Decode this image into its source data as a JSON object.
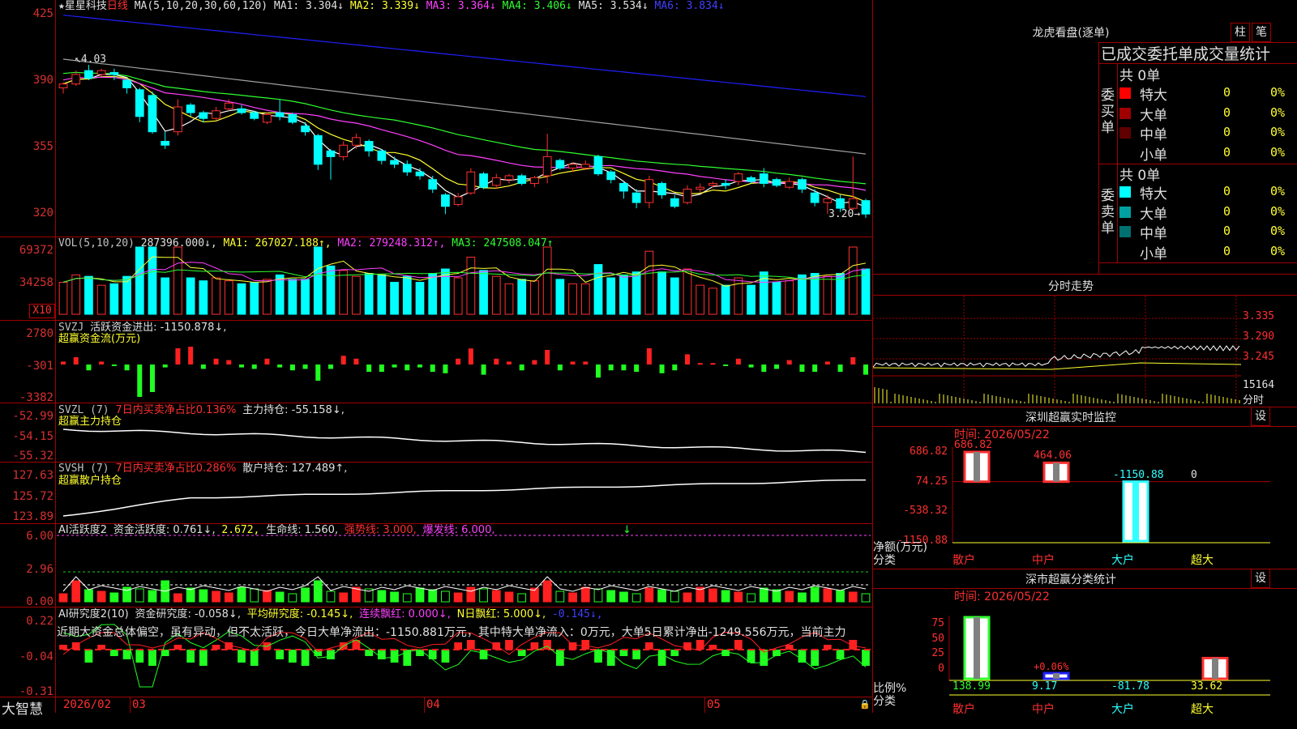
{
  "header": {
    "star": "★",
    "name": "星星科技",
    "period": "日线",
    "ma_label": "MA(5,10,20,30,60,120)",
    "ma1": "MA1: 3.304↓",
    "ma2": "MA2: 3.339↓",
    "ma3": "MA3: 3.364↓",
    "ma4": "MA4: 3.406↓",
    "ma5": "MA5: 3.534↓",
    "ma6": "MA6: 3.834↓",
    "high_tag": "4.03",
    "low_tag": "3.20"
  },
  "price_axis": [
    "425",
    "390",
    "355",
    "320"
  ],
  "vol": {
    "label": "VOL(5,10,20)",
    "value": "287396.000↓,",
    "ma1": "MA1: 267027.188↑,",
    "ma2": "MA2: 279248.312↑,",
    "ma3": "MA3: 247508.047↑",
    "axis": [
      "69372",
      "34258"
    ],
    "unit": "X10"
  },
  "svzj": {
    "label": "SVZJ",
    "text": "活跃资金进出: -1150.878↓,",
    "sub": "超赢资金流(万元)",
    "axis": [
      "2780",
      "-301",
      "-3382"
    ]
  },
  "svzl": {
    "label": "SVZL (7)",
    "text1": "7日内买卖净占比0.136%",
    "text2": "主力持仓: -55.158↓,",
    "sub": "超赢主力持仓",
    "axis": [
      "-52.99",
      "-54.15",
      "-55.32"
    ]
  },
  "svsh": {
    "label": "SVSH (7)",
    "text1": "7日内买卖净占比0.286%",
    "text2": "散户持仓: 127.489↑,",
    "sub": "超赢散户持仓",
    "axis": [
      "127.63",
      "125.72",
      "123.89"
    ]
  },
  "ai1": {
    "label": "AI活跃度2",
    "t1": "资金活跃度: 0.761↓,",
    "t2": "2.672,",
    "t3": "生命线: 1.560,",
    "t4": "强势线: 3.000,",
    "t5": "爆发线: 6.000,",
    "arrow": "↓",
    "axis": [
      "6.00",
      "2.96",
      "0.00"
    ]
  },
  "ai2": {
    "label": "AI研究度2(10)",
    "t1": "资金研究度: -0.058↓,",
    "t2": "平均研究度: -0.145↓,",
    "t3": "连续飘红: 0.000↓,",
    "t4": "N日飘红: 5.000↓,",
    "t5": "-0.145↓,",
    "desc": "近期大资金总体偏空，虽有异动，但不太活跃，今日大单净流出：-1150.881万元，其中特大单净流入：0万元，大单5日累计净出-1249.556万元，当前主力",
    "axis": [
      "0.22",
      "-0.04",
      "-0.31"
    ]
  },
  "bottom": {
    "brand": "大智慧",
    "dates": [
      "2026/02",
      "03",
      "04",
      "05"
    ]
  },
  "lhkp": {
    "title": "龙虎看盘(逐单)",
    "btn1": "柱",
    "btn2": "笔",
    "header": "已成交委托单成交量统计",
    "buy_side": "委买单",
    "sell_side": "委卖单",
    "buy_total": "共 0单",
    "sell_total": "共 0单",
    "buy_rows": [
      {
        "label": "特大",
        "count": "0",
        "pct": "0%",
        "color": "#ff0000"
      },
      {
        "label": "大单",
        "count": "0",
        "pct": "0%",
        "color": "#a00000"
      },
      {
        "label": "中单",
        "count": "0",
        "pct": "0%",
        "color": "#600000"
      },
      {
        "label": "小单",
        "count": "0",
        "pct": "0%",
        "color": ""
      }
    ],
    "sell_rows": [
      {
        "label": "特大",
        "count": "0",
        "pct": "0%",
        "color": "#00ffff"
      },
      {
        "label": "大单",
        "count": "0",
        "pct": "0%",
        "color": "#00a0a0"
      },
      {
        "label": "中单",
        "count": "0",
        "pct": "0%",
        "color": "#007070"
      },
      {
        "label": "小单",
        "count": "0",
        "pct": "0%",
        "color": ""
      }
    ]
  },
  "fenshi": {
    "title": "分时走势",
    "axis": [
      "3.335",
      "3.290",
      "3.245"
    ],
    "vol_label": "15164",
    "time_label": "分时"
  },
  "monitor": {
    "title": "深圳超赢实时监控",
    "btn": "设",
    "time": "时间: 2026/05/22",
    "axis": [
      "686.82",
      "74.25",
      "-538.32",
      "-1150.88"
    ],
    "values": [
      {
        "category": "散户",
        "value": 686.82,
        "label": "686.82"
      },
      {
        "category": "中户",
        "value": 464.06,
        "label": "464.06"
      },
      {
        "category": "大户",
        "value": -1150.88,
        "label": "-1150.88"
      },
      {
        "category": "超大",
        "value": 0,
        "label": "0"
      }
    ],
    "ylabel": "净额(万元)",
    "xlabel": "分类"
  },
  "classify": {
    "title": "深市超赢分类统计",
    "btn": "设",
    "time": "时间: 2026/05/22",
    "axis": [
      "75",
      "50",
      "25",
      "0"
    ],
    "values": [
      {
        "category": "散户",
        "pct": 138.99,
        "label": "138.99"
      },
      {
        "category": "中户",
        "pct": 9.17,
        "label": "9.17",
        "sub": "+0.06%"
      },
      {
        "category": "大户",
        "pct": -81.78,
        "label": "-81.78"
      },
      {
        "category": "超大",
        "pct": 33.62,
        "label": "33.62"
      }
    ],
    "ylabel": "比例%",
    "xlabel": "分类"
  },
  "chart_data": {
    "type": "candlestick",
    "title": "星星科技 日线",
    "ylim": [
      3.2,
      4.3
    ],
    "candles": [
      [
        3.88,
        3.9,
        3.85,
        3.91
      ],
      [
        3.9,
        3.95,
        3.89,
        3.97
      ],
      [
        3.97,
        3.93,
        3.92,
        4.0
      ],
      [
        3.95,
        3.97,
        3.94,
        3.98
      ],
      [
        3.96,
        3.95,
        3.92,
        3.98
      ],
      [
        3.92,
        3.88,
        3.85,
        3.93
      ],
      [
        3.87,
        3.73,
        3.7,
        3.88
      ],
      [
        3.84,
        3.65,
        3.64,
        3.86
      ],
      [
        3.6,
        3.58,
        3.56,
        3.65
      ],
      [
        3.65,
        3.78,
        3.63,
        3.82
      ],
      [
        3.79,
        3.75,
        3.73,
        3.8
      ],
      [
        3.75,
        3.72,
        3.7,
        3.76
      ],
      [
        3.72,
        3.76,
        3.71,
        3.78
      ],
      [
        3.77,
        3.8,
        3.76,
        3.82
      ],
      [
        3.77,
        3.75,
        3.74,
        3.79
      ],
      [
        3.75,
        3.72,
        3.71,
        3.76
      ],
      [
        3.7,
        3.74,
        3.69,
        3.75
      ],
      [
        3.75,
        3.73,
        3.71,
        3.82
      ],
      [
        3.74,
        3.7,
        3.69,
        3.75
      ],
      [
        3.68,
        3.65,
        3.63,
        3.7
      ],
      [
        3.63,
        3.48,
        3.45,
        3.64
      ],
      [
        3.55,
        3.52,
        3.4,
        3.56
      ],
      [
        3.52,
        3.58,
        3.5,
        3.6
      ],
      [
        3.58,
        3.62,
        3.56,
        3.64
      ],
      [
        3.6,
        3.55,
        3.52,
        3.61
      ],
      [
        3.55,
        3.5,
        3.48,
        3.56
      ],
      [
        3.5,
        3.48,
        3.46,
        3.52
      ],
      [
        3.48,
        3.44,
        3.42,
        3.5
      ],
      [
        3.44,
        3.42,
        3.4,
        3.46
      ],
      [
        3.4,
        3.35,
        3.33,
        3.42
      ],
      [
        3.32,
        3.26,
        3.22,
        3.33
      ],
      [
        3.27,
        3.31,
        3.26,
        3.33
      ],
      [
        3.33,
        3.44,
        3.32,
        3.46
      ],
      [
        3.43,
        3.36,
        3.35,
        3.44
      ],
      [
        3.37,
        3.41,
        3.35,
        3.43
      ],
      [
        3.4,
        3.42,
        3.38,
        3.43
      ],
      [
        3.42,
        3.38,
        3.37,
        3.43
      ],
      [
        3.38,
        3.41,
        3.36,
        3.42
      ],
      [
        3.42,
        3.52,
        3.38,
        3.64
      ],
      [
        3.5,
        3.46,
        3.45,
        3.51
      ],
      [
        3.46,
        3.48,
        3.44,
        3.49
      ],
      [
        3.46,
        3.48,
        3.45,
        3.5
      ],
      [
        3.52,
        3.43,
        3.42,
        3.53
      ],
      [
        3.44,
        3.4,
        3.38,
        3.45
      ],
      [
        3.38,
        3.34,
        3.3,
        3.39
      ],
      [
        3.33,
        3.28,
        3.25,
        3.35
      ],
      [
        3.28,
        3.4,
        3.25,
        3.42
      ],
      [
        3.38,
        3.32,
        3.3,
        3.39
      ],
      [
        3.3,
        3.26,
        3.25,
        3.32
      ],
      [
        3.28,
        3.35,
        3.27,
        3.37
      ],
      [
        3.35,
        3.36,
        3.33,
        3.38
      ],
      [
        3.37,
        3.38,
        3.36,
        3.39
      ],
      [
        3.38,
        3.37,
        3.35,
        3.4
      ],
      [
        3.39,
        3.43,
        3.37,
        3.44
      ],
      [
        3.41,
        3.39,
        3.38,
        3.42
      ],
      [
        3.43,
        3.38,
        3.36,
        3.46
      ],
      [
        3.4,
        3.37,
        3.36,
        3.41
      ],
      [
        3.36,
        3.39,
        3.35,
        3.41
      ],
      [
        3.4,
        3.35,
        3.33,
        3.41
      ],
      [
        3.33,
        3.28,
        3.26,
        3.35
      ],
      [
        3.28,
        3.3,
        3.22,
        3.32
      ],
      [
        3.3,
        3.25,
        3.23,
        3.32
      ],
      [
        3.25,
        3.3,
        3.24,
        3.52
      ],
      [
        3.29,
        3.22,
        3.2,
        3.3
      ]
    ],
    "ma_series": [
      {
        "name": "MA1",
        "color": "#ffffff"
      },
      {
        "name": "MA2",
        "color": "#ffff30"
      },
      {
        "name": "MA3",
        "color": "#ff40ff"
      },
      {
        "name": "MA4",
        "color": "#30ff30"
      },
      {
        "name": "MA5",
        "color": "#a0a0a0"
      },
      {
        "name": "MA6",
        "color": "#2020ff"
      }
    ],
    "ma5_endpoints": [
      4.03,
      3.534
    ],
    "ma6_endpoints": [
      4.26,
      3.834
    ]
  }
}
